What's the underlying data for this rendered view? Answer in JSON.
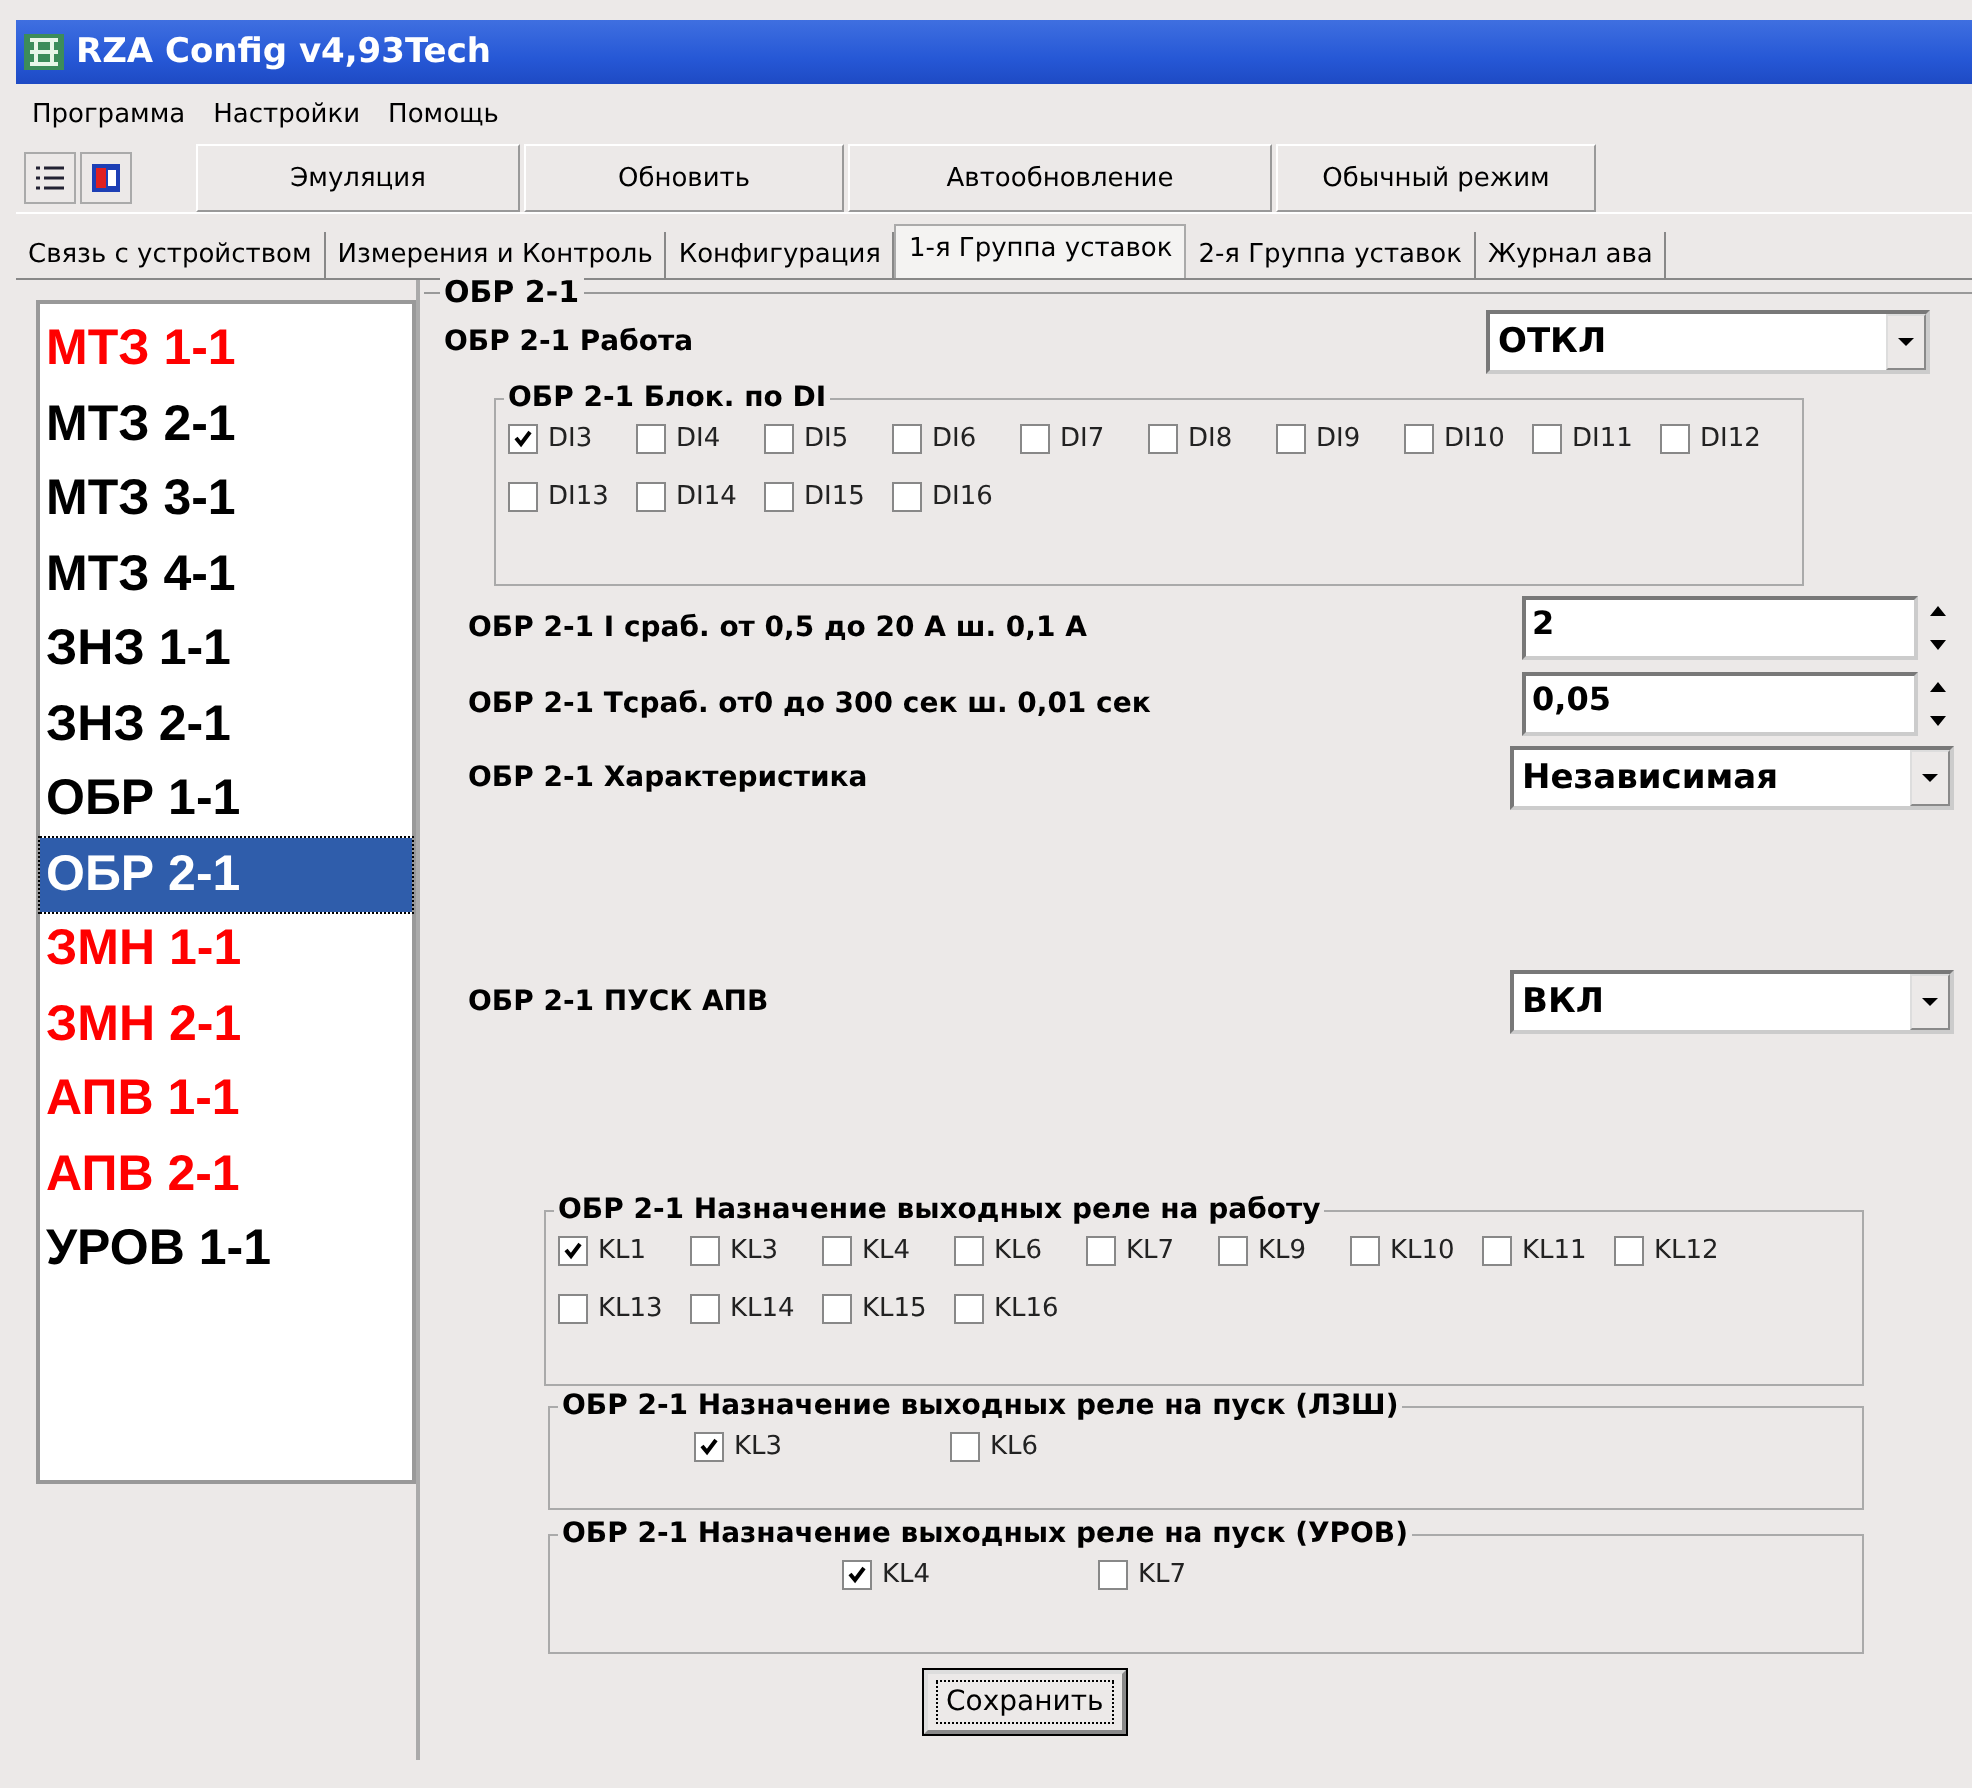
{
  "window": {
    "title": "RZA Config v4,93Tech"
  },
  "menu": [
    "Программа",
    "Настройки",
    "Помощь"
  ],
  "toolbar": {
    "buttons": [
      "Эмуляция",
      "Обновить",
      "Автообновление",
      "Обычный режим"
    ]
  },
  "tabs": [
    {
      "label": "Связь с устройством",
      "selected": false
    },
    {
      "label": "Измерения и Контроль",
      "selected": false
    },
    {
      "label": "Конфигурация",
      "selected": false
    },
    {
      "label": "1-я Группа уставок",
      "selected": true
    },
    {
      "label": "2-я Группа уставок",
      "selected": false
    },
    {
      "label": "Журнал ава",
      "selected": false
    }
  ],
  "sidebar": {
    "items": [
      {
        "label": "МТЗ 1-1",
        "color": "#ff0000",
        "selected": false
      },
      {
        "label": "МТЗ 2-1",
        "color": "#000000",
        "selected": false
      },
      {
        "label": "МТЗ 3-1",
        "color": "#000000",
        "selected": false
      },
      {
        "label": "МТЗ 4-1",
        "color": "#000000",
        "selected": false
      },
      {
        "label": "ЗНЗ 1-1",
        "color": "#000000",
        "selected": false
      },
      {
        "label": "ЗНЗ 2-1",
        "color": "#000000",
        "selected": false
      },
      {
        "label": "ОБР 1-1",
        "color": "#000000",
        "selected": false
      },
      {
        "label": "ОБР 2-1",
        "selected": true
      },
      {
        "label": "ЗМН 1-1",
        "color": "#ff0000",
        "selected": false
      },
      {
        "label": "ЗМН 2-1",
        "color": "#ff0000",
        "selected": false
      },
      {
        "label": "АПВ 1-1",
        "color": "#ff0000",
        "selected": false
      },
      {
        "label": "АПВ 2-1",
        "color": "#ff0000",
        "selected": false
      },
      {
        "label": "УРОВ 1-1",
        "color": "#000000",
        "selected": false
      }
    ]
  },
  "panel": {
    "title": "ОБР 2-1",
    "rows": [
      {
        "kind": "select",
        "label": "ОБР 2-1 Работа",
        "value": "ОТКЛ"
      },
      {
        "kind": "group",
        "title": "ОБР 2-1 Блок. по DI",
        "options": [
          {
            "label": "DI3",
            "checked": true
          },
          {
            "label": "DI4",
            "checked": false
          },
          {
            "label": "DI5",
            "checked": false
          },
          {
            "label": "DI6",
            "checked": false
          },
          {
            "label": "DI7",
            "checked": false
          },
          {
            "label": "DI8",
            "checked": false
          },
          {
            "label": "DI9",
            "checked": false
          },
          {
            "label": "DI10",
            "checked": false
          },
          {
            "label": "DI11",
            "checked": false
          },
          {
            "label": "DI12",
            "checked": false
          },
          {
            "label": "DI13",
            "checked": false
          },
          {
            "label": "DI14",
            "checked": false
          },
          {
            "label": "DI15",
            "checked": false
          },
          {
            "label": "DI16",
            "checked": false
          }
        ]
      },
      {
        "kind": "spin",
        "label": "ОБР 2-1 I сраб. от 0,5 до 20 А ш. 0,1 А",
        "value": "2"
      },
      {
        "kind": "spin",
        "label": "ОБР 2-1 Tсраб. от0 до 300 сек ш. 0,01 сек",
        "value": "0,05"
      },
      {
        "kind": "select",
        "label": "ОБР 2-1 Характеристика",
        "value": "Независимая"
      },
      {
        "kind": "select",
        "label": "ОБР 2-1 ПУСК АПВ",
        "value": "ВКЛ"
      },
      {
        "kind": "group",
        "title": "ОБР 2-1 Назначение выходных реле на работу",
        "options": [
          {
            "label": "KL1",
            "checked": true
          },
          {
            "label": "KL3",
            "checked": false
          },
          {
            "label": "KL4",
            "checked": false
          },
          {
            "label": "KL6",
            "checked": false
          },
          {
            "label": "KL7",
            "checked": false
          },
          {
            "label": "KL9",
            "checked": false
          },
          {
            "label": "KL10",
            "checked": false
          },
          {
            "label": "KL11",
            "checked": false
          },
          {
            "label": "KL12",
            "checked": false
          },
          {
            "label": "KL13",
            "checked": false
          },
          {
            "label": "KL14",
            "checked": false
          },
          {
            "label": "KL15",
            "checked": false
          },
          {
            "label": "KL16",
            "checked": false
          }
        ]
      },
      {
        "kind": "group",
        "title": "ОБР 2-1 Назначение выходных реле на пуск (ЛЗШ)",
        "options": [
          {
            "label": "KL3",
            "checked": true
          },
          {
            "label": "KL6",
            "checked": false
          }
        ]
      },
      {
        "kind": "group",
        "title": "ОБР 2-1 Назначение выходных реле на пуск (УРОВ)",
        "options": [
          {
            "label": "KL4",
            "checked": true
          },
          {
            "label": "KL7",
            "checked": false
          }
        ]
      }
    ],
    "save_button": "Сохранить"
  }
}
